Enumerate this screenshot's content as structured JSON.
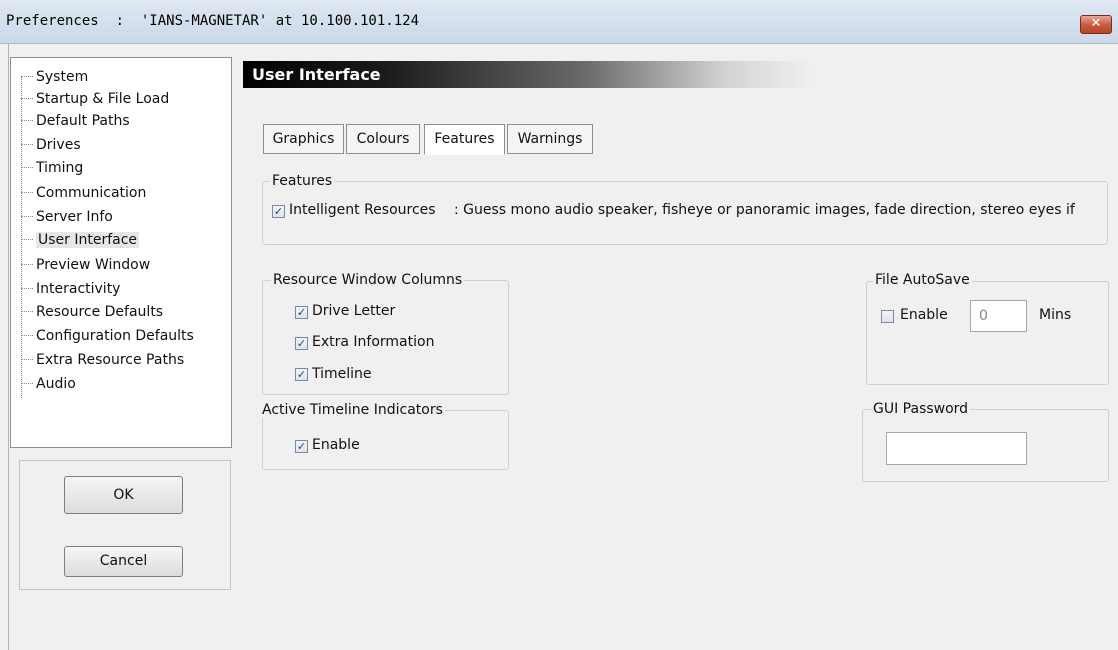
{
  "window": {
    "title": "Preferences  :  'IANS-MAGNETAR' at 10.100.101.124",
    "close_glyph": "✕"
  },
  "tree": {
    "items": [
      {
        "label": "System"
      },
      {
        "label": "Startup & File Load"
      },
      {
        "label": "Default Paths"
      },
      {
        "label": "Drives"
      },
      {
        "label": "Timing"
      },
      {
        "label": "Communication"
      },
      {
        "label": "Server Info"
      },
      {
        "label": "User Interface",
        "selected": true
      },
      {
        "label": "Preview Window"
      },
      {
        "label": "Interactivity"
      },
      {
        "label": "Resource Defaults"
      },
      {
        "label": "Configuration Defaults"
      },
      {
        "label": "Extra Resource Paths"
      },
      {
        "label": "Audio"
      }
    ]
  },
  "buttons": {
    "ok": "OK",
    "cancel": "Cancel"
  },
  "section": {
    "title": "User Interface"
  },
  "tabs": [
    {
      "label": "Graphics"
    },
    {
      "label": "Colours"
    },
    {
      "label": "Features",
      "active": true
    },
    {
      "label": "Warnings"
    }
  ],
  "features": {
    "title": "Features",
    "intelligent_label": "Intelligent Resources",
    "intelligent_checked": true,
    "intelligent_desc": ": Guess mono audio speaker, fisheye or panoramic images, fade direction, stereo eyes if"
  },
  "columns": {
    "title": "Resource Window Columns",
    "items": [
      {
        "label": "Drive Letter",
        "checked": true
      },
      {
        "label": "Extra Information",
        "checked": true
      },
      {
        "label": "Timeline",
        "checked": true
      }
    ]
  },
  "timeline": {
    "title": "Active Timeline Indicators",
    "enable_label": "Enable",
    "enable_checked": true
  },
  "autosave": {
    "title": "File AutoSave",
    "enable_label": "Enable",
    "enable_checked": false,
    "minutes_value": "0",
    "units": "Mins"
  },
  "password": {
    "title": "GUI Password",
    "value": ""
  },
  "colors": {
    "checkmark": "#1d3f8e",
    "header_start": "#000000",
    "close_button": "#c75a3b"
  },
  "icons": {
    "checkbox_checked": "✓",
    "close": "close-icon"
  }
}
